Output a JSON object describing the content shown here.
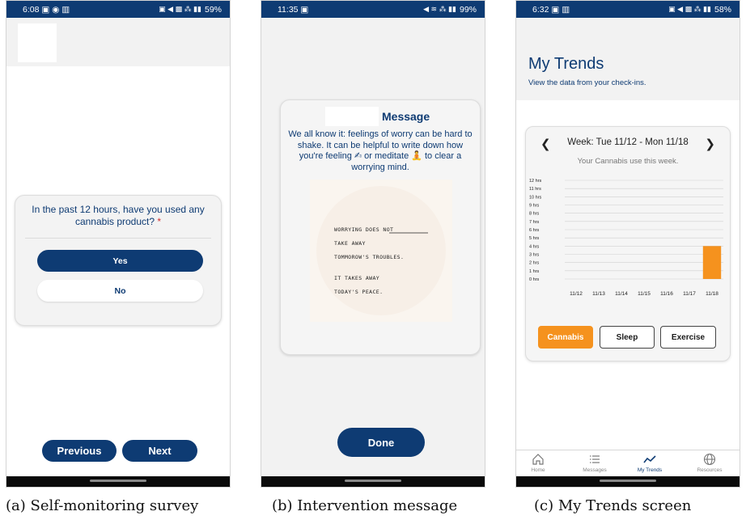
{
  "screens": [
    {
      "status": {
        "time": "6:08",
        "left_icons": "▣ ◉ ▥",
        "right_icons": "▣ ◀ ▩ ⁂ ▮▮",
        "battery": "59%"
      },
      "question": "In the past 12 hours, have you used any cannabis product?",
      "required_mark": "*",
      "options": [
        "Yes",
        "No"
      ],
      "prev_label": "Previous",
      "next_label": "Next"
    },
    {
      "status": {
        "time": "11:35",
        "left_icons": "▣",
        "right_icons": "◀ ≋ ⁂ ▮▮",
        "battery": "99%"
      },
      "title": "Message",
      "body": "We all know it: feelings of worry can be hard to shake. It can be helpful to write down how you're feeling ✍ or meditate 🧘 to clear a worrying mind.",
      "quote_lines": [
        "WORRYING DOES NOT",
        "TAKE AWAY",
        "TOMMOROW'S TROUBLES.",
        "IT TAKES AWAY",
        "TODAY'S PEACE."
      ],
      "done_label": "Done"
    },
    {
      "status": {
        "time": "6:32",
        "left_icons": "▣ ▥",
        "right_icons": "▣ ◀ ▩ ⁂ ▮▮",
        "battery": "58%"
      },
      "title": "My Trends",
      "subtitle": "View the data from your check-ins.",
      "week_label": "Week: Tue 11/12 - Mon 11/18",
      "prev_week_icon": "chevron-left-icon",
      "next_week_icon": "chevron-right-icon",
      "use_label": "Your Cannabis use this week.",
      "chart_data": {
        "type": "bar",
        "categories": [
          "11/12",
          "11/13",
          "11/14",
          "11/15",
          "11/16",
          "11/17",
          "11/18"
        ],
        "values": [
          0,
          0,
          0,
          0,
          0,
          0,
          4
        ],
        "y_ticks": [
          "0 hrs",
          "1 hrs",
          "2 hrs",
          "3 hrs",
          "4 hrs",
          "5 hrs",
          "6 hrs",
          "7 hrs",
          "8 hrs",
          "9 hrs",
          "10 hrs",
          "11 hrs",
          "12 hrs"
        ],
        "ylim": [
          0,
          12
        ],
        "grid": true,
        "bar_color": "#f5921e"
      },
      "tabs": [
        "Cannabis",
        "Sleep",
        "Exercise"
      ],
      "nav": [
        {
          "label": "Home",
          "icon": "home-icon"
        },
        {
          "label": "Messages",
          "icon": "list-icon"
        },
        {
          "label": "My Trends",
          "icon": "trend-icon"
        },
        {
          "label": "Resources",
          "icon": "globe-icon"
        }
      ]
    }
  ],
  "captions": [
    "(a) Self-monitoring survey",
    "(b) Intervention message",
    "(c) My Trends screen"
  ],
  "colors": {
    "primary": "#0e3b73",
    "accent": "#f5921e",
    "required": "#d32f2f"
  }
}
